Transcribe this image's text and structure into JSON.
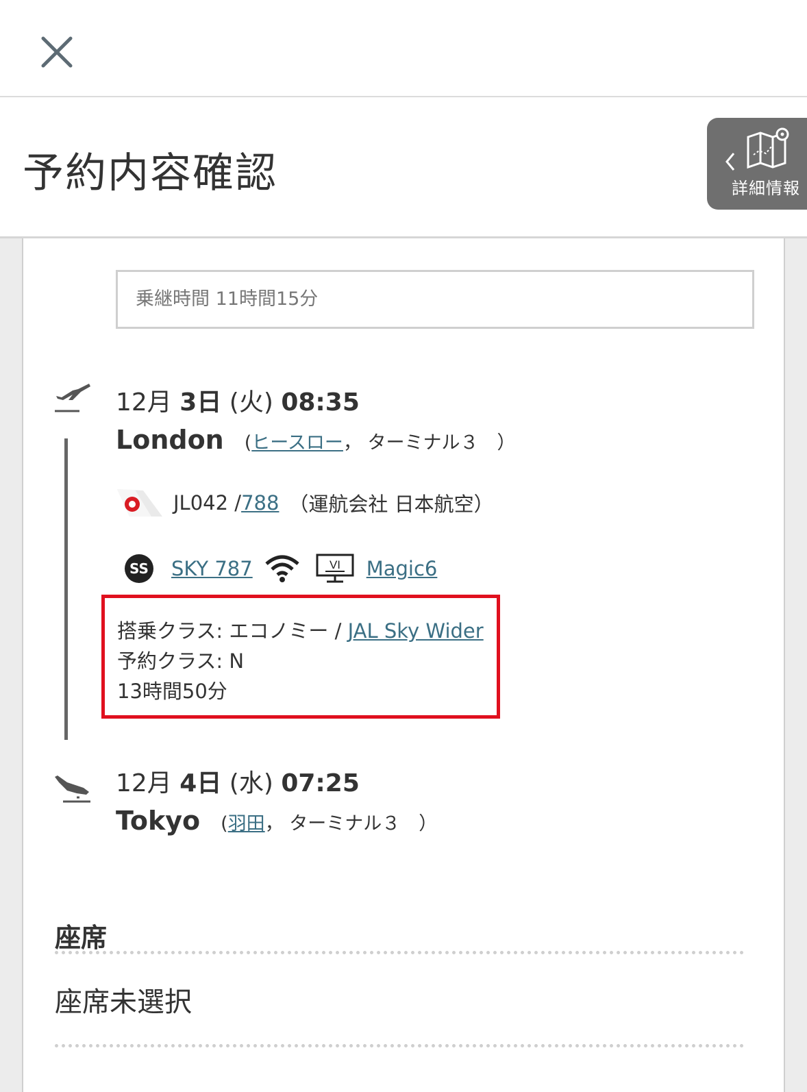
{
  "header": {
    "title": "予約内容確認",
    "details_label": "詳細情報"
  },
  "transfer": {
    "text": "乗継時間 11時間15分"
  },
  "departure": {
    "date_prefix": "12月 ",
    "day": "3日",
    "weekday": " (火) ",
    "time": "08:35",
    "city": "London",
    "open_paren": "(",
    "airport": "ヒースロー",
    "terminal": "， ターミナル３　）"
  },
  "flight": {
    "number": "JL042  /  ",
    "aircraft": "788",
    "operator": "（運航会社 日本航空）"
  },
  "amenities": {
    "seat_badge": "SS",
    "seat_name": "SKY 787 ",
    "ent_badge": "VI",
    "entertainment": "Magic6"
  },
  "class_info": {
    "cabin_prefix": "搭乗クラス: エコノミー / ",
    "cabin_product": "JAL Sky Wider",
    "booking_class": "予約クラス: N",
    "duration": "13時間50分"
  },
  "arrival": {
    "date_prefix": "12月 ",
    "day": "4日",
    "weekday": " (水) ",
    "time": "07:25",
    "city": "Tokyo",
    "open_paren": "(",
    "airport": "羽田",
    "terminal": "， ターミナル３　）"
  },
  "seat": {
    "title": "座席",
    "status": "座席未選択"
  },
  "colors": {
    "highlight": "#e0101e",
    "link": "#3b6f84",
    "tab_bg": "#6f6f6f"
  }
}
